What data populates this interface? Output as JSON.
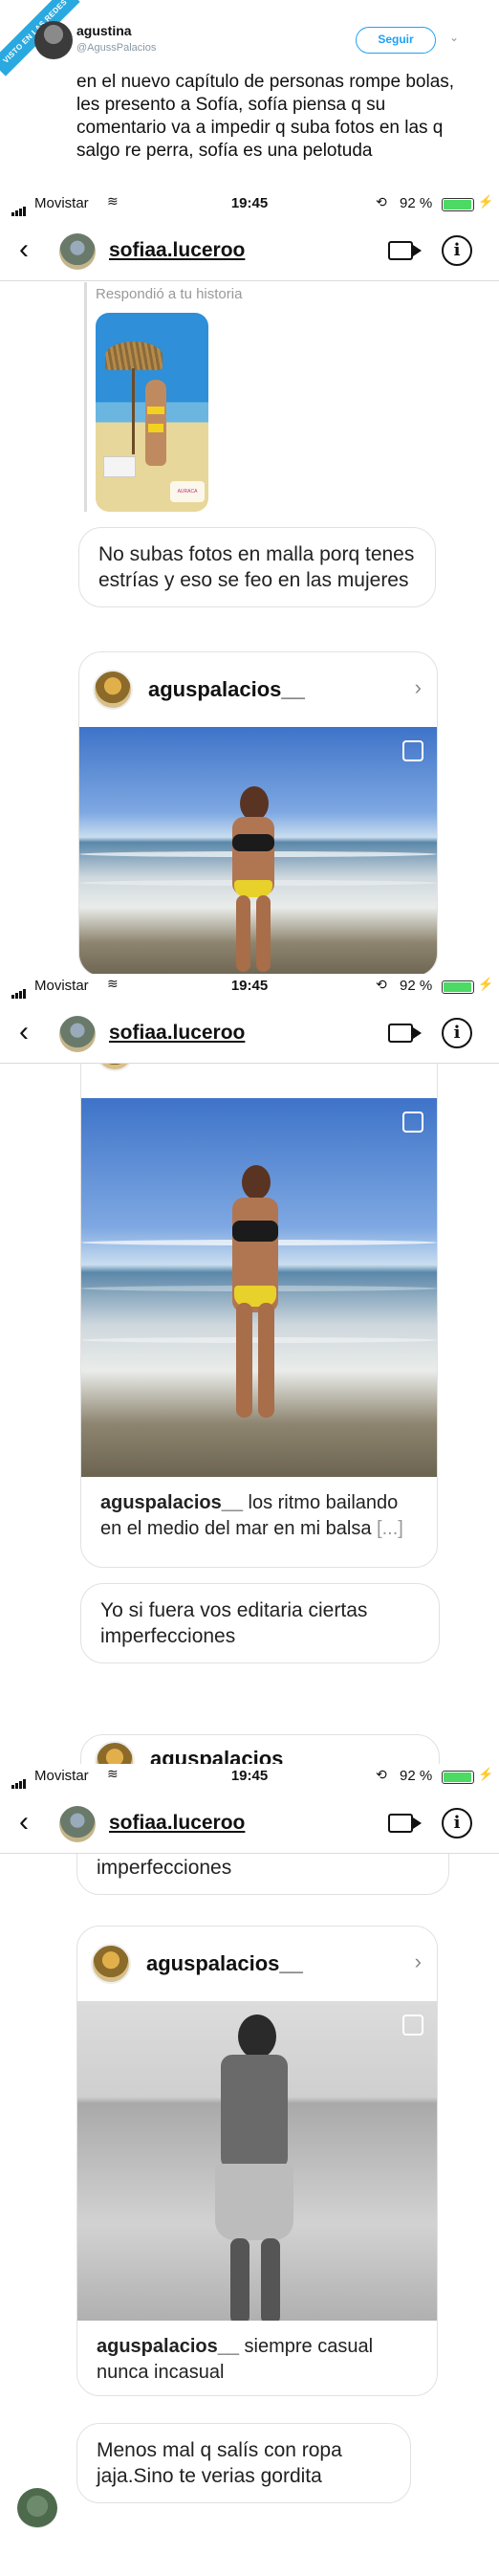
{
  "ribbon": "VISTO EN LAS REDES",
  "tweet": {
    "name": "agustina",
    "handle": "@AgussPalacios",
    "follow_label": "Seguir",
    "text": "en el nuevo capítulo de personas rompe bolas, les presento a Sofía, sofía piensa q su comentario va a impedir q suba fotos en las q salgo re perra, sofía es una pelotuda"
  },
  "status_bar": {
    "carrier": "Movistar",
    "time": "19:45",
    "battery_percent": "92 %",
    "battery_level": 0.92
  },
  "chat_header": {
    "username": "sofiaa.luceroo"
  },
  "story_reply": {
    "label": "Respondió a tu historia",
    "sticker_text": "AURACA"
  },
  "messages": {
    "m1": "No subas fotos en malla porq tenes estrías y eso se feo en las mujeres",
    "m2": "Yo si fuera vos editaria ciertas imperfecciones",
    "m2_cut": "Yo si fuera vos editaria ciertas imperfecciones",
    "m3": "Menos mal q salís con ropa jaja.Sino te verias gordita"
  },
  "posts": {
    "author": "aguspalacios__",
    "author_cut": "aguspalacios",
    "p1_caption_user": "aguspalacios__",
    "p1_caption_text": " los ritmo bailando en el medio del mar en mi balsa ",
    "p1_caption_more": "[...]",
    "p2_caption_user": "aguspalacios__",
    "p2_caption_text": " siempre casual nunca incasual"
  },
  "icons": [
    "back-chevron-icon",
    "video-call-icon",
    "info-icon",
    "wifi-icon",
    "signal-icon",
    "battery-icon",
    "chevron-right-icon"
  ]
}
